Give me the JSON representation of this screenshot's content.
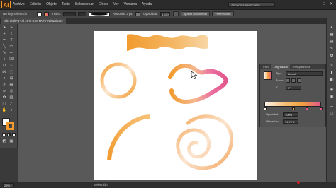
{
  "app": {
    "logo": "Ai"
  },
  "menu": [
    "Archivo",
    "Edición",
    "Objeto",
    "Texto",
    "Seleccionar",
    "Efecto",
    "Ver",
    "Ventana",
    "Ayuda"
  ],
  "search_placeholder": "Aspectos esenciales",
  "control_bar": {
    "selection_label": "No hay selección",
    "stroke_label": "Trazo:",
    "brush_label": "Redondo 3 pt.",
    "style_label": "Estilo:",
    "opacity_label": "Opacidad:",
    "opacity_value": "100%",
    "doc_setup_button": "Ajustar documento",
    "preferences_button": "Preferencias"
  },
  "document_tab": "Sin título-1* al 29% (CMYK/Previsualizar)",
  "gradient_panel": {
    "tabs": [
      "Trazo",
      "Degradado",
      "Transparencia"
    ],
    "active_tab": "Degradado",
    "type_label": "Tipo:",
    "type_value": "Lineal",
    "stroke_label": "Trazo:",
    "angle_value": "0°",
    "opacity_label": "Opacidad:",
    "opacity_value": "100%",
    "location_label": "Ubicación:",
    "location_value": "74,71%",
    "stops": [
      {
        "color": "#fdf3ea",
        "position": 0
      },
      {
        "color": "#f2a13c",
        "position": 0.5
      },
      {
        "color": "#e3588c",
        "position": 0.75
      },
      {
        "color": "#e3588c",
        "position": 1
      }
    ]
  },
  "statusbar": {
    "zoom": "29%",
    "selection_tool": "Selección"
  },
  "colors": {
    "accent_orange": "#f29a2e",
    "pink": "#e3588c",
    "artboard": "#ffffff"
  }
}
